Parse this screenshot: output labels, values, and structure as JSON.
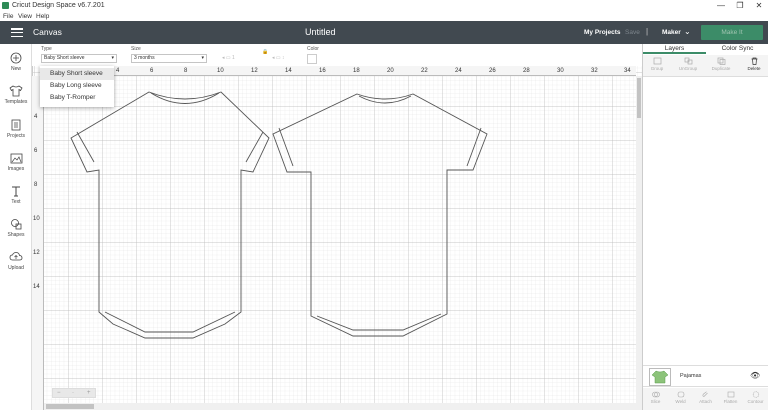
{
  "window": {
    "title": "Cricut Design Space  v6.7.201",
    "controls": [
      "—",
      "❐",
      "✕"
    ]
  },
  "menu": [
    "File",
    "View",
    "Help"
  ],
  "header": {
    "section": "Canvas",
    "document_title": "Untitled",
    "my_projects": "My Projects",
    "save": "Save",
    "separator": "|",
    "machine": "Maker",
    "make_it": "Make It"
  },
  "toolbar": {
    "type_label": "Type",
    "type_value": "Baby Short sleeve",
    "size_label": "Size",
    "size_value": "3 months",
    "color_label": "Color"
  },
  "dropdown": {
    "options": [
      "Baby Short sleeve",
      "Baby Long sleeve",
      "Baby T-Romper"
    ],
    "selected_index": 0
  },
  "sidebar": {
    "items": [
      {
        "label": "New",
        "icon": "plus-circle-icon"
      },
      {
        "label": "Templates",
        "icon": "shirt-icon"
      },
      {
        "label": "Projects",
        "icon": "projects-icon"
      },
      {
        "label": "Images",
        "icon": "image-icon"
      },
      {
        "label": "Text",
        "icon": "text-icon"
      },
      {
        "label": "Shapes",
        "icon": "shapes-icon"
      },
      {
        "label": "Upload",
        "icon": "upload-cloud-icon"
      }
    ]
  },
  "ruler": {
    "top": [
      "4",
      "6",
      "8",
      "10",
      "12",
      "14",
      "16",
      "18",
      "20",
      "22",
      "24",
      "26",
      "28",
      "30",
      "32",
      "34"
    ],
    "left": [
      "4",
      "6",
      "8",
      "10",
      "12",
      "14"
    ]
  },
  "right_panel": {
    "tabs": [
      "Layers",
      "Color Sync"
    ],
    "actions": [
      "Group",
      "UnGroup",
      "Duplicate",
      "Delete"
    ],
    "layer_name": "Pajamas",
    "bottom_actions": [
      "Slice",
      "Weld",
      "Attach",
      "Flatten",
      "Contour"
    ]
  },
  "colors": {
    "header_bg": "#414950",
    "accent": "#3c8c68"
  }
}
